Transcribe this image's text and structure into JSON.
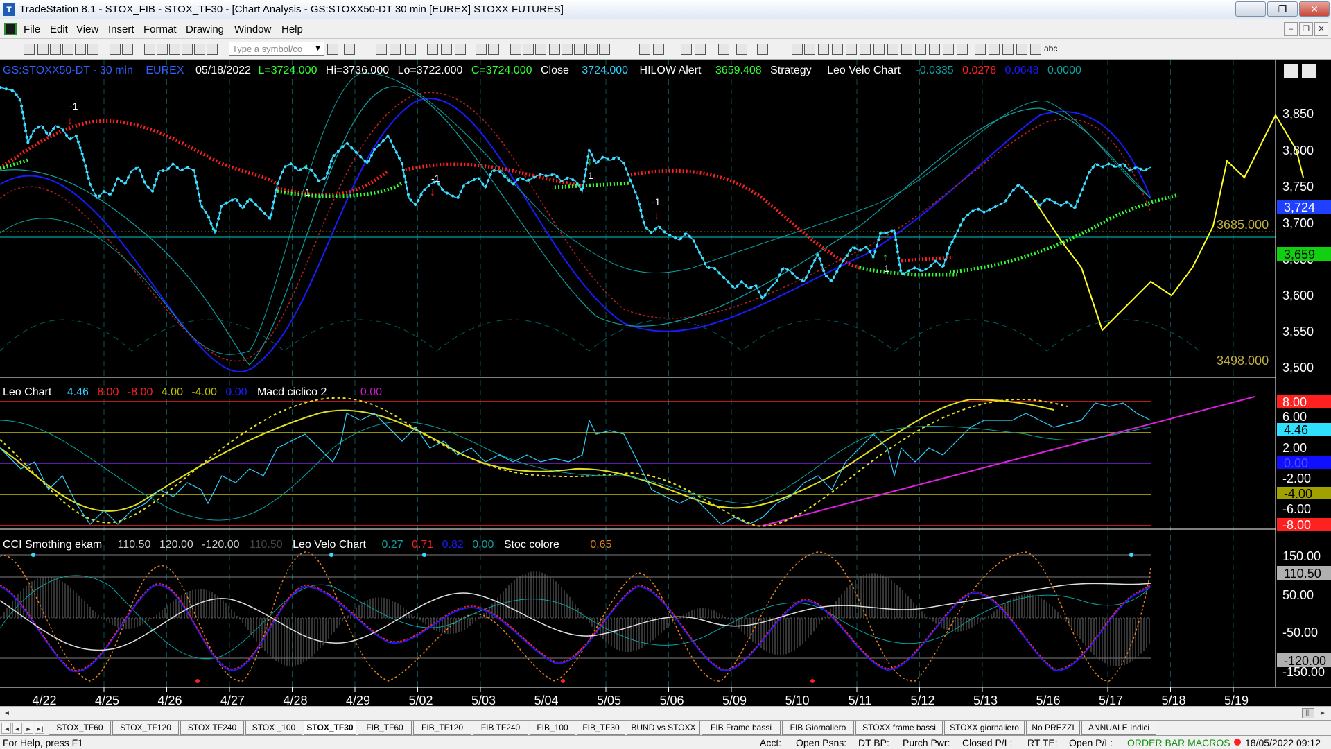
{
  "window": {
    "title": "TradeStation 8.1 - STOX_FIB - STOX_TF30 - [Chart Analysis - GS:STOXX50-DT  30 min  [EUREX] STOXX FUTURES]",
    "min_label": "—",
    "max_label": "❐",
    "close_label": "✕"
  },
  "menu": {
    "items": [
      "File",
      "Edit",
      "View",
      "Insert",
      "Format",
      "Drawing",
      "Window",
      "Help"
    ],
    "mdi": [
      "–",
      "❐",
      "✕"
    ]
  },
  "toolbar": {
    "symbol_placeholder": "Type a symbol/co",
    "dd": "▼",
    "abc": "abc"
  },
  "chart": {
    "header": {
      "symbol": "GS:STOXX50-DT - 30 min",
      "exchange": "EUREX",
      "date": "05/18/2022",
      "last": "L=3724.000",
      "high": "Hi=3736.000",
      "low": "Lo=3722.000",
      "close_c": "C=3724.000",
      "close_lbl": "Close",
      "close_val": "3724.000",
      "hilow_lbl": "HILOW Alert",
      "hilow_val": "3659.408",
      "strategy": "Strategy",
      "leovelo": "Leo Velo Chart",
      "lv1": "-0.0335",
      "lv2": "0.0278",
      "lv3": "0.0648",
      "lv4": "0.0000"
    },
    "price_ticks": [
      "3,850",
      "3,800",
      "3,750",
      "3,700",
      "3,650",
      "3,600",
      "3,550",
      "3,500"
    ],
    "price_badges": {
      "current": "3,724",
      "hilow": "3,659"
    },
    "levels": {
      "upper": "3685.000",
      "lower": "3498.000"
    },
    "signals": {
      "sell": "-1",
      "buy": "1",
      "sell_arrow": "↓",
      "buy_arrow": "↑"
    },
    "osc_header": {
      "name": "Leo Chart",
      "v1": "4.46",
      "v2": "8.00",
      "v3": "-8.00",
      "v4": "4.00",
      "v5": "-4.00",
      "v6": "0.00",
      "macd": "Macd ciclico 2",
      "v7": "0.00"
    },
    "osc_ticks": [
      "6.00",
      "2.00",
      "-2.00",
      "-6.00"
    ],
    "osc_badges": {
      "b8": "8.00",
      "cur": "4.46",
      "b0": "0.00",
      "bm4": "-4.00",
      "bm8": "-8.00"
    },
    "cci_header": {
      "name": "CCI Smothing ekam",
      "v1": "110.50",
      "v2": "120.00",
      "v3": "-120.00",
      "v4": "110.50",
      "leovelo": "Leo Velo Chart",
      "v5": "0.27",
      "v6": "0.71",
      "v7": "0.82",
      "v8": "0.00",
      "stoc": "Stoc colore",
      "v9": "0.65"
    },
    "cci_ticks": [
      "150.00",
      "50.00",
      "-50.00",
      "-150.00"
    ],
    "cci_badges": {
      "cur": "110.50",
      "neg": "-120.00"
    },
    "dates": [
      "4/22",
      "4/25",
      "4/26",
      "4/27",
      "4/28",
      "4/29",
      "5/02",
      "5/03",
      "5/04",
      "5/05",
      "5/06",
      "5/09",
      "5/10",
      "5/11",
      "5/12",
      "5/13",
      "5/16",
      "5/17",
      "5/18",
      "5/19"
    ]
  },
  "scroll": {
    "left": "◄",
    "right": "►",
    "thumb": "|||"
  },
  "tabs": {
    "nav": [
      "|◄",
      "◄",
      "►",
      "►|"
    ],
    "items": [
      "STOX_TF60",
      "STOX_TF120",
      "STOX TF240",
      "STOX _100",
      "STOX_TF30",
      "FIB_TF60",
      "FIB_TF120",
      "FIB TF240",
      "FIB_100",
      "FIB_TF30",
      "BUND vs STOXX",
      "FIB Frame bassi",
      "FIB Giornaliero",
      "STOXX frame bassi",
      "STOXX giornaliero",
      "No PREZZI",
      "ANNUALE Indici"
    ],
    "active": "STOX_TF30"
  },
  "status": {
    "help": "For Help, press F1",
    "acct": "Acct:",
    "open_psns": "Open Psns:",
    "dtbp": "DT BP:",
    "purch": "Purch Pwr:",
    "closed": "Closed P/L:",
    "rtte": "RT TE:",
    "openpl": "Open P/L:",
    "macros": "ORDER BAR  MACROS",
    "datetime": "18/05/2022 09:12"
  }
}
